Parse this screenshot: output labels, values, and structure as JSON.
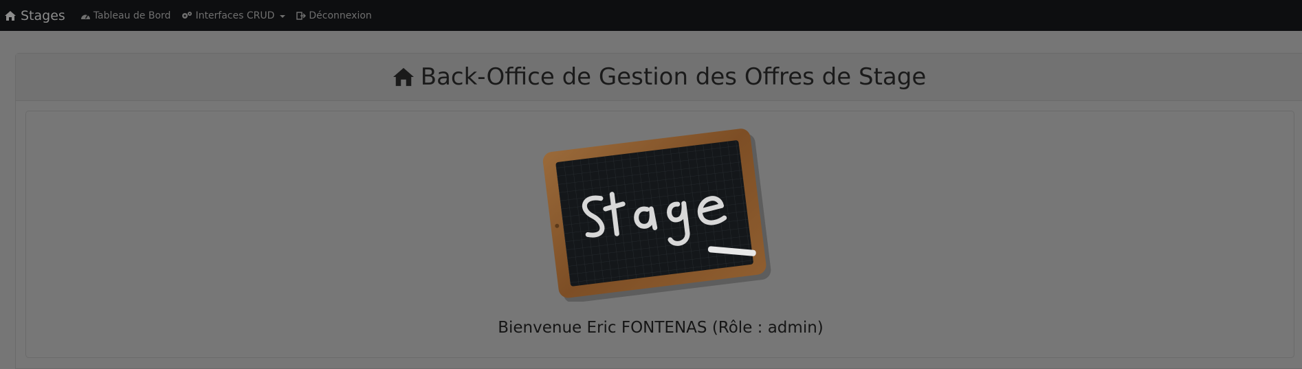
{
  "navbar": {
    "brand": {
      "label": "Stages",
      "icon": "home-icon"
    },
    "items": [
      {
        "label": "Tableau de Bord",
        "icon": "dashboard-icon"
      },
      {
        "label": "Interfaces CRUD",
        "icon": "cogs-icon",
        "dropdown": true
      },
      {
        "label": "Déconnexion",
        "icon": "logout-icon"
      }
    ]
  },
  "header": {
    "title": "Back-Office de Gestion des Offres de Stage",
    "icon": "home-icon"
  },
  "hero": {
    "image_text": "Stage"
  },
  "welcome": {
    "text": "Bienvenue Eric FONTENAS (Rôle : admin)"
  },
  "colors": {
    "navbar_bg": "#0d0e10",
    "overlay_bg": "#767676",
    "text_dark": "#1a1a1a",
    "slate_frame": "#8a5a2e",
    "slate_board": "#14171a"
  }
}
